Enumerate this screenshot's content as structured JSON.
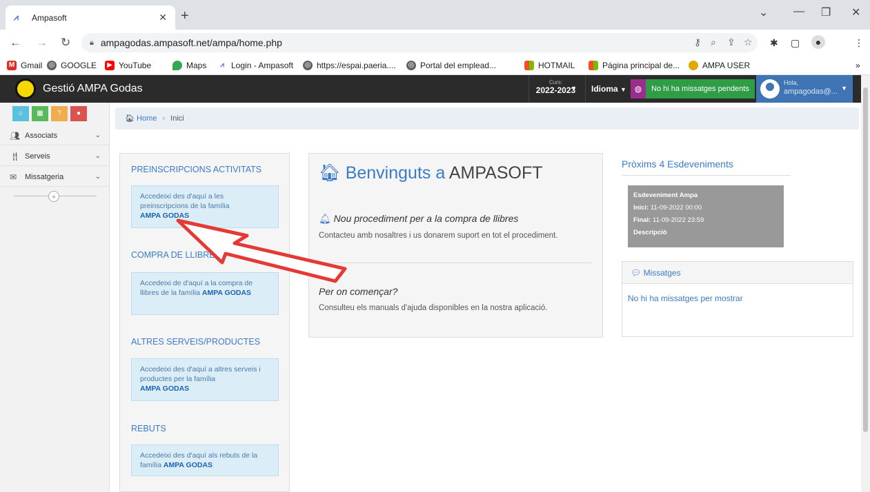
{
  "browser": {
    "tab_title": "Ampasoft",
    "url": "ampagodas.ampasoft.net/ampa/home.php",
    "bookmarks": [
      {
        "label": "Gmail",
        "color": "#d93025"
      },
      {
        "label": "GOOGLE",
        "color": "#5f6368"
      },
      {
        "label": "YouTube",
        "color": "#ff0000"
      },
      {
        "label": "Maps",
        "color": "#34a853"
      },
      {
        "label": "Login - Ampasoft",
        "color": "#3a6fd8"
      },
      {
        "label": "https://espai.paeria....",
        "color": "#5f6368"
      },
      {
        "label": "Portal del emplead...",
        "color": "#5f6368"
      },
      {
        "label": "HOTMAIL",
        "color": "#f25022"
      },
      {
        "label": "Página principal de...",
        "color": "#f25022"
      },
      {
        "label": "AMPA USER",
        "color": "#e0a800"
      }
    ]
  },
  "header": {
    "title": "Gestió AMPA Godas",
    "curs_label": "Curs:",
    "curs_value": "2022-2023",
    "idioma": "Idioma",
    "messages": "No hi ha missatges pendents",
    "hola": "Hola,",
    "user": "ampagodas@..."
  },
  "sidebar": {
    "items": [
      {
        "label": "Associats"
      },
      {
        "label": "Serveis"
      },
      {
        "label": "Missatgeria"
      }
    ]
  },
  "breadcrumb": {
    "home": "Home",
    "current": "Inici"
  },
  "sections": [
    {
      "title": "PREINSCRIPCIONS ACTIVITATS",
      "text": "Accedeixi des d'aquí a les preinscripcions de la família",
      "strong": "AMPA GODAS"
    },
    {
      "title": "COMPRA DE LLIBRES",
      "text": "Accedeixi de d'aquí a la compra de llibres de la família",
      "strong": "AMPA GODAS"
    },
    {
      "title": "ALTRES SERVEIS/PRODUCTES",
      "text": "Accedeixi des d'aquí a altres serveis i productes per la família",
      "strong": "AMPA GODAS"
    },
    {
      "title": "REBUTS",
      "text": "Accedeixi des d'aquí als rebuts de la família",
      "strong": "AMPA GODAS"
    }
  ],
  "center": {
    "welcome_prefix": "Benvinguts a",
    "welcome_brand": "AMPASOFT",
    "h1": "Nou procediment per a la compra de llibres",
    "p1": "Contacteu amb nosaltres i us donarem suport en tot el procediment.",
    "h2": "Per on començar?",
    "p2": "Consulteu els manuals d'ajuda disponibles en la nostra aplicació."
  },
  "events": {
    "title": "Pròxims 4 Esdeveniments",
    "name": "Esdeveniment Ampa",
    "start_label": "Inici:",
    "start": "11-09-2022 00:00",
    "end_label": "Final:",
    "end": "11-09-2022 23:59",
    "desc_label": "Descripció"
  },
  "messages_panel": {
    "title": "Missatges",
    "empty": "No hi ha missatges per mostrar"
  },
  "colors": {
    "accent": "#3a7bc8",
    "header": "#2b2b2b",
    "arrow": "#e53935"
  }
}
